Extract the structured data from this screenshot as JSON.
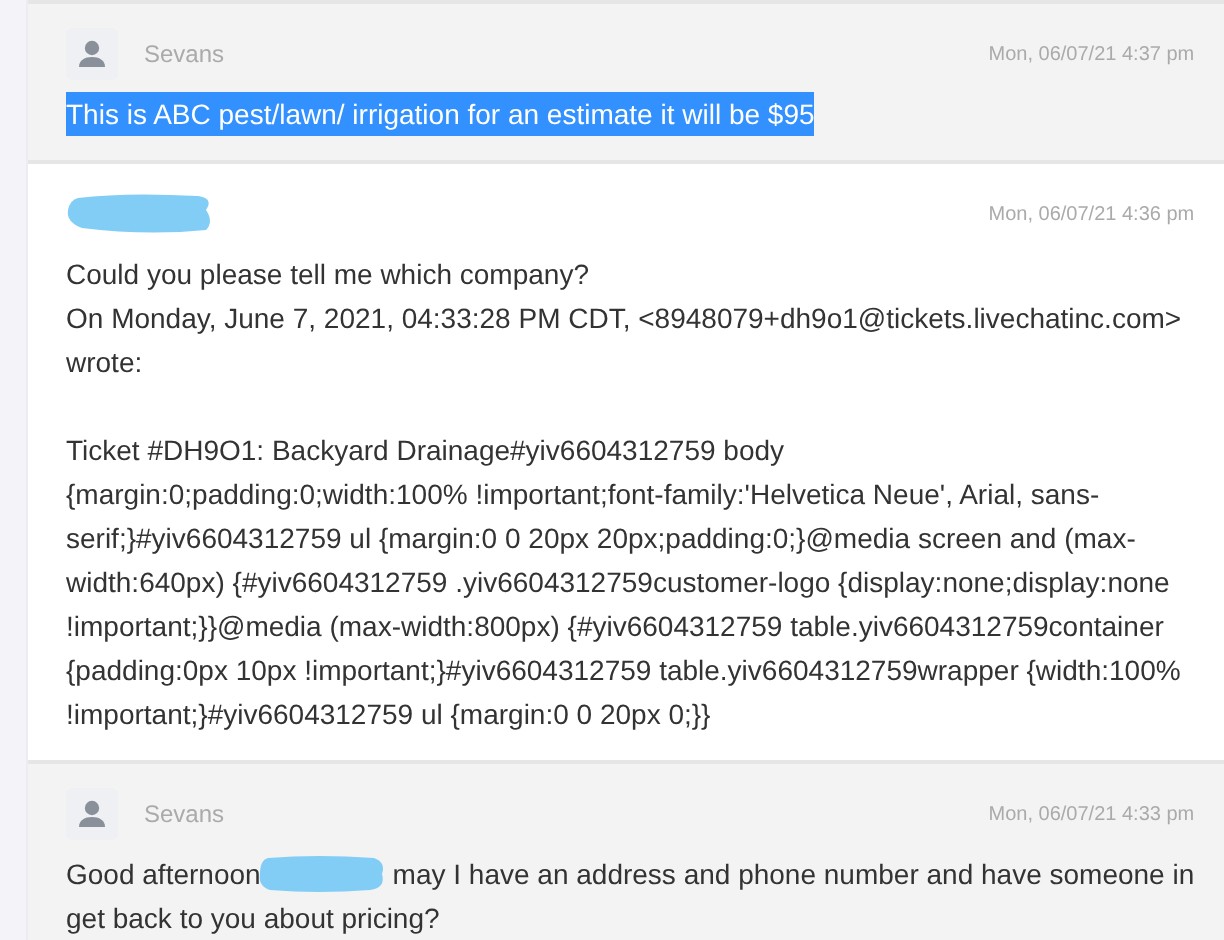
{
  "messages": [
    {
      "author": "Sevans",
      "avatar": true,
      "redacted_author": false,
      "time": "Mon, 06/07/21 4:37 pm",
      "shaded": true,
      "paragraphs": [
        {
          "highlighted": true,
          "lines": [
            "This is ABC pest/lawn/ irrigation for an estimate it will be $95"
          ]
        }
      ]
    },
    {
      "avatar": false,
      "redacted_author": true,
      "time": "Mon, 06/07/21 4:36 pm",
      "shaded": false,
      "paragraphs": [
        {
          "highlighted": false,
          "lines": [
            "Could you please tell me which company?",
            "On Monday, June 7, 2021, 04:33:28 PM CDT, <8948079+dh9o1@tickets.livechatinc.com>",
            "wrote:"
          ]
        },
        {
          "highlighted": false,
          "lines": [
            "Ticket #DH9O1: Backyard Drainage#yiv6604312759 body",
            "{margin:0;padding:0;width:100% !important;font-family:'Helvetica Neue', Arial, sans-",
            "serif;}#yiv6604312759 ul {margin:0 0 20px 20px;padding:0;}@media screen and (max-",
            "width:640px) {#yiv6604312759 .yiv6604312759customer-logo {display:none;display:none",
            "!important;}}@media (max-width:800px) {#yiv6604312759 table.yiv6604312759container",
            "{padding:0px 10px !important;}#yiv6604312759 table.yiv6604312759wrapper {width:100%",
            "!important;}#yiv6604312759 ul {margin:0 0 20px 0;}}"
          ]
        }
      ]
    },
    {
      "author": "Sevans",
      "avatar": true,
      "redacted_author": false,
      "time": "Mon, 06/07/21 4:33 pm",
      "shaded": true,
      "paragraphs": [
        {
          "highlighted": false,
          "redacted_after": "Good afternoon",
          "lines": [
            "may I have an address and phone number and have someone in",
            "get back to you about pricing?"
          ]
        }
      ]
    }
  ]
}
